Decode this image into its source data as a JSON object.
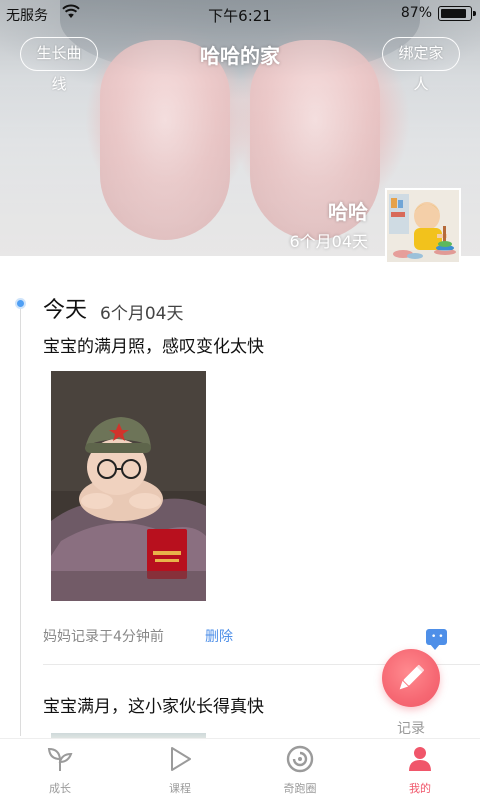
{
  "status_bar": {
    "carrier": "无服务",
    "time": "下午6:21",
    "battery": "87%",
    "battery_level": 0.87
  },
  "header": {
    "left_button": "生长曲线",
    "title": "哈哈的家",
    "right_button": "绑定家人",
    "baby_name": "哈哈",
    "baby_age": "6个月04天"
  },
  "timeline": {
    "day_title": "今天",
    "day_age": "6个月04天",
    "posts": [
      {
        "text": "宝宝的满月照，感叹变化太快",
        "meta": "妈妈记录于4分钟前",
        "delete_label": "删除"
      },
      {
        "text": "宝宝满月，这小家伙长得真快"
      }
    ]
  },
  "fab": {
    "label": "记录",
    "icon": "pencil-icon"
  },
  "tabbar": {
    "tabs": [
      {
        "label": "成长",
        "icon": "sprout-icon",
        "active": false
      },
      {
        "label": "课程",
        "icon": "play-icon",
        "active": false
      },
      {
        "label": "奇跑圈",
        "icon": "circle-icon",
        "active": false
      },
      {
        "label": "我的",
        "icon": "person-icon",
        "active": true
      }
    ]
  },
  "colors": {
    "accent_blue": "#4e8fe8",
    "accent_red": "#f0566a",
    "timeline_dot": "#4f9ff4"
  }
}
